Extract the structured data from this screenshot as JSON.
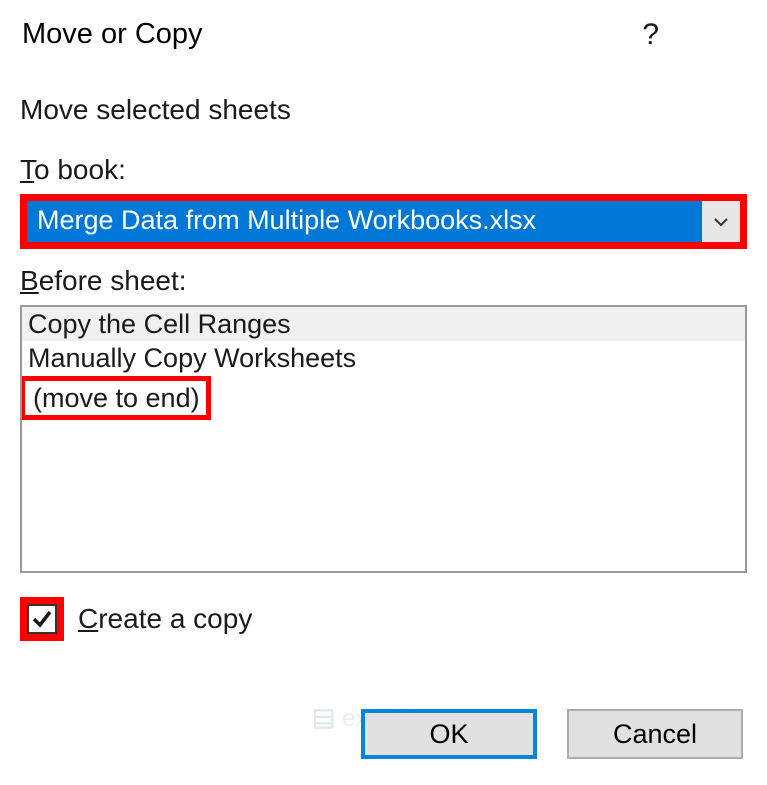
{
  "dialog": {
    "title": "Move or Copy",
    "section_header": "Move selected sheets",
    "to_book_label_prefix": "T",
    "to_book_label_rest": "o book:",
    "dropdown_selected": "Merge Data from Multiple Workbooks.xlsx",
    "before_sheet_label_prefix": "B",
    "before_sheet_label_rest": "efore sheet:",
    "sheets": [
      "Copy the Cell Ranges",
      "Manually Copy Worksheets",
      "(move to end)"
    ],
    "checkbox_prefix": "C",
    "checkbox_rest": "reate a copy",
    "checkbox_checked": true,
    "ok_label": "OK",
    "cancel_label": "Cancel"
  },
  "watermark": "exceldemy"
}
